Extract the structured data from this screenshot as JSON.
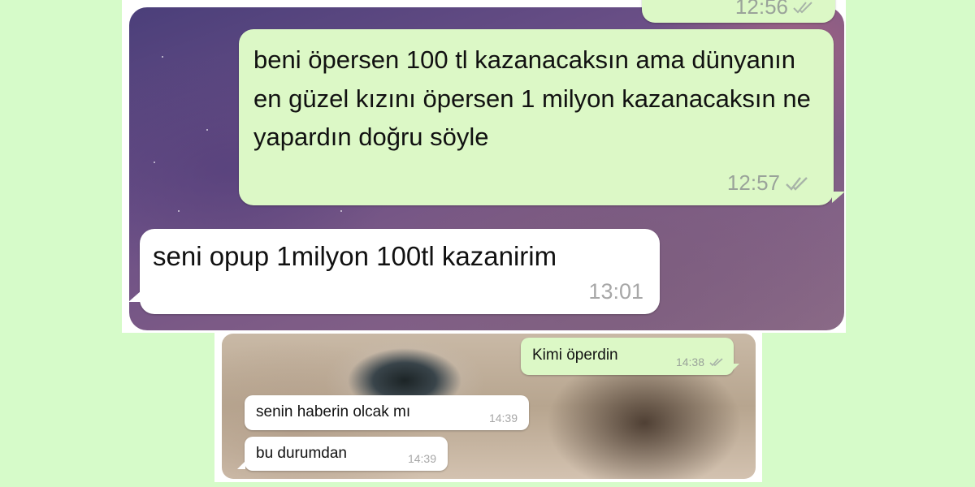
{
  "colors": {
    "page_background": "#d6fbc9",
    "outgoing_bubble": "#dcf8c6",
    "incoming_bubble": "#ffffff",
    "timestamp": "#9aa39a"
  },
  "screenshot_top": {
    "messages": [
      {
        "direction": "outgoing",
        "text": "",
        "time": "12:56",
        "status_icon": "double-check-icon"
      },
      {
        "direction": "outgoing",
        "text": "beni öpersen 100 tl kazanacaksın ama dünyanın en güzel kızını öpersen 1 milyon kazanacaksın ne yapardın doğru söyle",
        "time": "12:57",
        "status_icon": "double-check-icon"
      },
      {
        "direction": "incoming",
        "text": "seni opup 1milyon 100tl kazanirim",
        "time": "13:01"
      }
    ]
  },
  "screenshot_bottom": {
    "messages": [
      {
        "direction": "outgoing",
        "text": "Kimi öperdin",
        "time": "14:38",
        "status_icon": "double-check-icon"
      },
      {
        "direction": "incoming",
        "text": "senin haberin olcak mı",
        "time": "14:39"
      },
      {
        "direction": "incoming",
        "text": "bu durumdan",
        "time": "14:39"
      }
    ]
  }
}
